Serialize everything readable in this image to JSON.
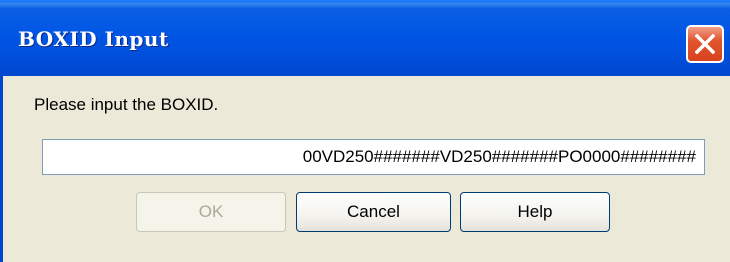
{
  "window": {
    "title": "BOXID Input"
  },
  "dialog": {
    "prompt": "Please input the BOXID.",
    "input_value": "00VD250#######VD250#######PO0000########"
  },
  "buttons": {
    "ok_label": "OK",
    "cancel_label": "Cancel",
    "help_label": "Help",
    "ok_enabled": false
  },
  "icons": {
    "close": "close-icon"
  },
  "colors": {
    "titlebar": "#0055e5",
    "close_button": "#e2552d",
    "dialog_background": "#ece9d8",
    "input_border": "#7f9db9",
    "button_border": "#003c74"
  }
}
